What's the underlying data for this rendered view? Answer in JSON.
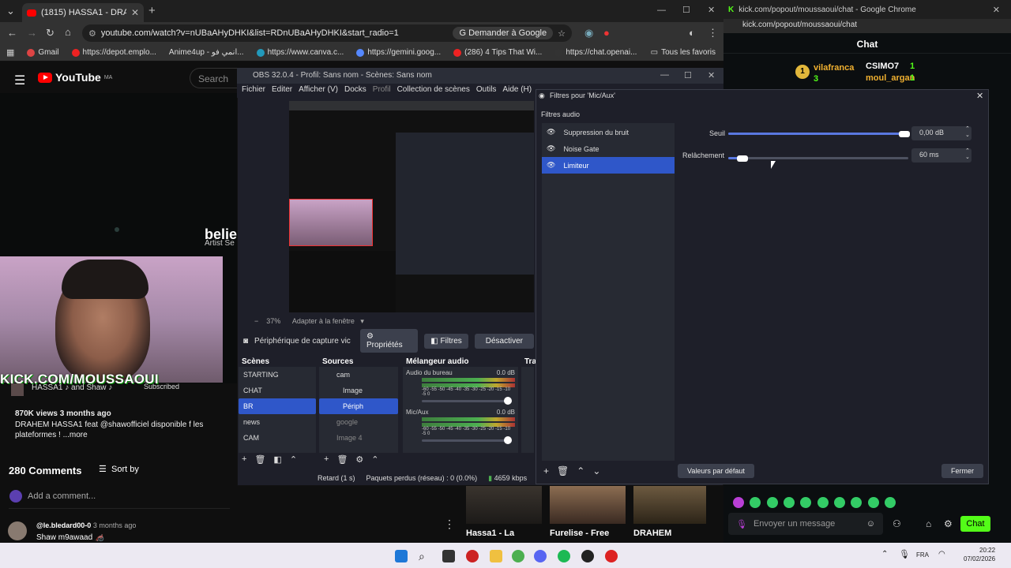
{
  "chrome": {
    "tab_title": "(1815) HASSA1 - DRAHEM - fe",
    "url": "youtube.com/watch?v=nUBaAHyDHKI&list=RDnUBaAHyDHKI&start_radio=1",
    "translate_label": "Demander à Google",
    "bookmarks": [
      "Gmail",
      "https://depot.emplo...",
      "Anime4up - انمي فو...",
      "https://www.canva.c...",
      "https://gemini.goog...",
      "(286) 4 Tips That Wi...",
      "https://chat.openai...",
      "Tous les favoris"
    ]
  },
  "youtube": {
    "logo": "YouTube",
    "logo_country": "MA",
    "search_placeholder": "Search",
    "video_title": "belie",
    "video_sub": "Artist Se",
    "cam_banner": "KICK.COM/MOUSSAOUI",
    "channel_line": "HASSA1 ♪ and Shaw ♪",
    "subscribed": "Subscribed",
    "views": "870K views  3 months ago",
    "desc_line1": "DRAHEM HASSA1  feat @shawofficiel  disponible f les",
    "desc_line2": "plateformes !  ...more",
    "comments_count": "280 Comments",
    "sort_by": "Sort by",
    "add_comment": "Add a comment...",
    "comment_author": "@le.bledard00-0",
    "comment_time": "3 months ago",
    "comment_text": "Shaw m9awaad 🦽"
  },
  "kick": {
    "window_title": "kick.com/popout/moussaoui/chat - Google Chrome",
    "url": "kick.com/popout/moussaoui/chat",
    "header": "Chat",
    "leaderboard": [
      {
        "name": "vilafranca",
        "count": "3"
      },
      {
        "name": "CSIMO7",
        "count": "1"
      },
      {
        "name": "moul_argan",
        "count": "1"
      }
    ],
    "input_placeholder": "Envoyer un message",
    "chat_button": "Chat",
    "thumbs": [
      "Hassa1 - La",
      "Furelise - Free",
      "DRAHEM"
    ]
  },
  "obs": {
    "title": "OBS 32.0.4 - Profil: Sans nom - Scènes: Sans nom",
    "menu": [
      "Fichier",
      "Editer",
      "Afficher (V)",
      "Docks",
      "Profil",
      "Collection de scènes",
      "Outils",
      "Aide (H)"
    ],
    "zoom": "37%",
    "fit_label": "Adapter à la fenêtre",
    "source_name": "Périphérique de capture vic",
    "btn_props": "Propriétés",
    "btn_filters": "Filtres",
    "btn_disable": "Désactiver",
    "scenes_header": "Scènes",
    "scenes": [
      "STARTING",
      "CHAT",
      "BR",
      "news",
      "CAM"
    ],
    "selected_scene": "BR",
    "sources_header": "Sources",
    "sources": [
      "cam",
      "Image",
      "Périph",
      "google",
      "Image 4"
    ],
    "mixer_header": "Mélangeur audio",
    "transitions_header": "Tra",
    "mixer": [
      {
        "name": "Audio du bureau",
        "db": "0.0 dB"
      },
      {
        "name": "Mic/Aux",
        "db": "0.0 dB"
      }
    ],
    "meter_ticks": "-60 -55 -50 -45 -40 -35 -30 -25 -20 -15 -10 -5 0",
    "status_delay": "Retard (1 s)",
    "status_dropped": "Paquets perdus (réseau) : 0 (0.0%)",
    "status_bitrate": "4659 kbps"
  },
  "filters": {
    "title": "Filtres pour 'Mic/Aux'",
    "section": "Filtres audio",
    "items": [
      "Suppression du bruit",
      "Noise Gate",
      "Limiteur"
    ],
    "selected": "Limiteur",
    "threshold_label": "Seuil",
    "threshold_value": "0,00 dB",
    "threshold_fraction": 0.98,
    "release_label": "Relâchement",
    "release_value": "60 ms",
    "release_fraction": 0.08,
    "defaults_btn": "Valeurs par défaut",
    "close_btn": "Fermer"
  },
  "taskbar": {
    "lang": "FRA",
    "time": "20:22",
    "date": "07/02/2026"
  },
  "colors": {
    "accent_blue": "#2f57c9",
    "kick_green": "#53fc18",
    "yt_red": "#ff0000"
  }
}
